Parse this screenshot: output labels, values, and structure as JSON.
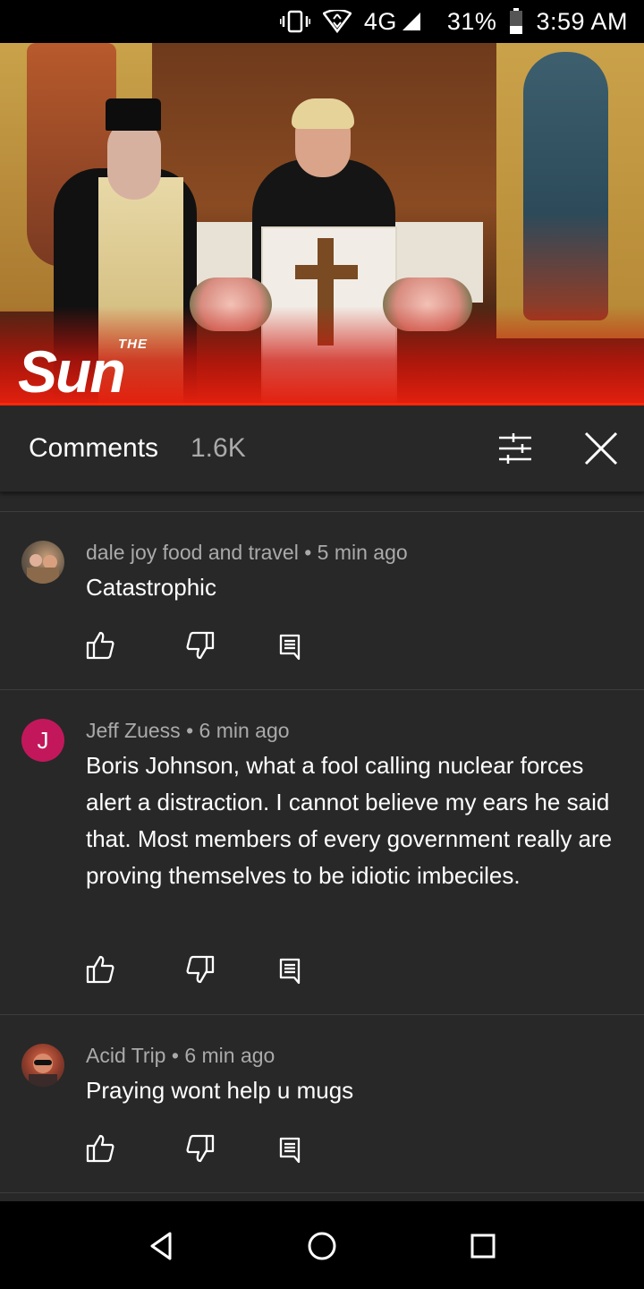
{
  "status_bar": {
    "network": "4G",
    "battery": "31%",
    "time": "3:59 AM"
  },
  "video": {
    "logo_small": "THE",
    "logo_main": "Sun"
  },
  "comments_panel": {
    "title": "Comments",
    "count": "1.6K"
  },
  "comments": [
    {
      "author": "dale joy food and travel",
      "time": "5 min ago",
      "text": "Catastrophic",
      "avatar_type": "photo"
    },
    {
      "author": "Jeff Zuess",
      "time": "6 min ago",
      "text": "Boris Johnson, what a fool calling nuclear forces alert a distraction. I cannot believe my ears he said that. Most members of every government really are proving themselves to be idiotic imbeciles.",
      "avatar_type": "letter",
      "avatar_letter": "J"
    },
    {
      "author": "Acid Trip",
      "time": "6 min ago",
      "text": "Praying wont help u mugs",
      "avatar_type": "photo"
    }
  ],
  "colors": {
    "background": "#282828",
    "accent_red": "#ff2a0a",
    "avatar_j": "#c2185b"
  }
}
